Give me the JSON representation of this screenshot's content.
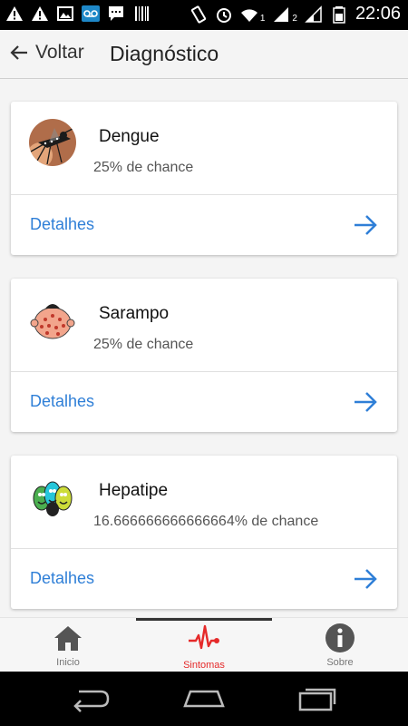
{
  "status_bar": {
    "time": "22:06",
    "sim1": "1",
    "sim2": "2"
  },
  "header": {
    "back_label": "Voltar",
    "title": "Diagnóstico"
  },
  "diagnoses": [
    {
      "name": "Dengue",
      "chance": "25% de chance",
      "action": "Detalhes",
      "image": "mosquito"
    },
    {
      "name": "Sarampo",
      "chance": "25% de chance",
      "action": "Detalhes",
      "image": "measles-face"
    },
    {
      "name": "Hepatipe",
      "chance": "16.666666666666664% de chance",
      "action": "Detalhes",
      "image": "virus-cartoon"
    }
  ],
  "tabs": [
    {
      "label": "Inicio",
      "icon": "home-icon",
      "active": false
    },
    {
      "label": "Sintomas",
      "icon": "heartbeat-icon",
      "active": true
    },
    {
      "label": "Sobre",
      "icon": "info-icon",
      "active": false
    }
  ],
  "colors": {
    "link": "#2f7fd7",
    "active_tab": "#e52a2a"
  }
}
